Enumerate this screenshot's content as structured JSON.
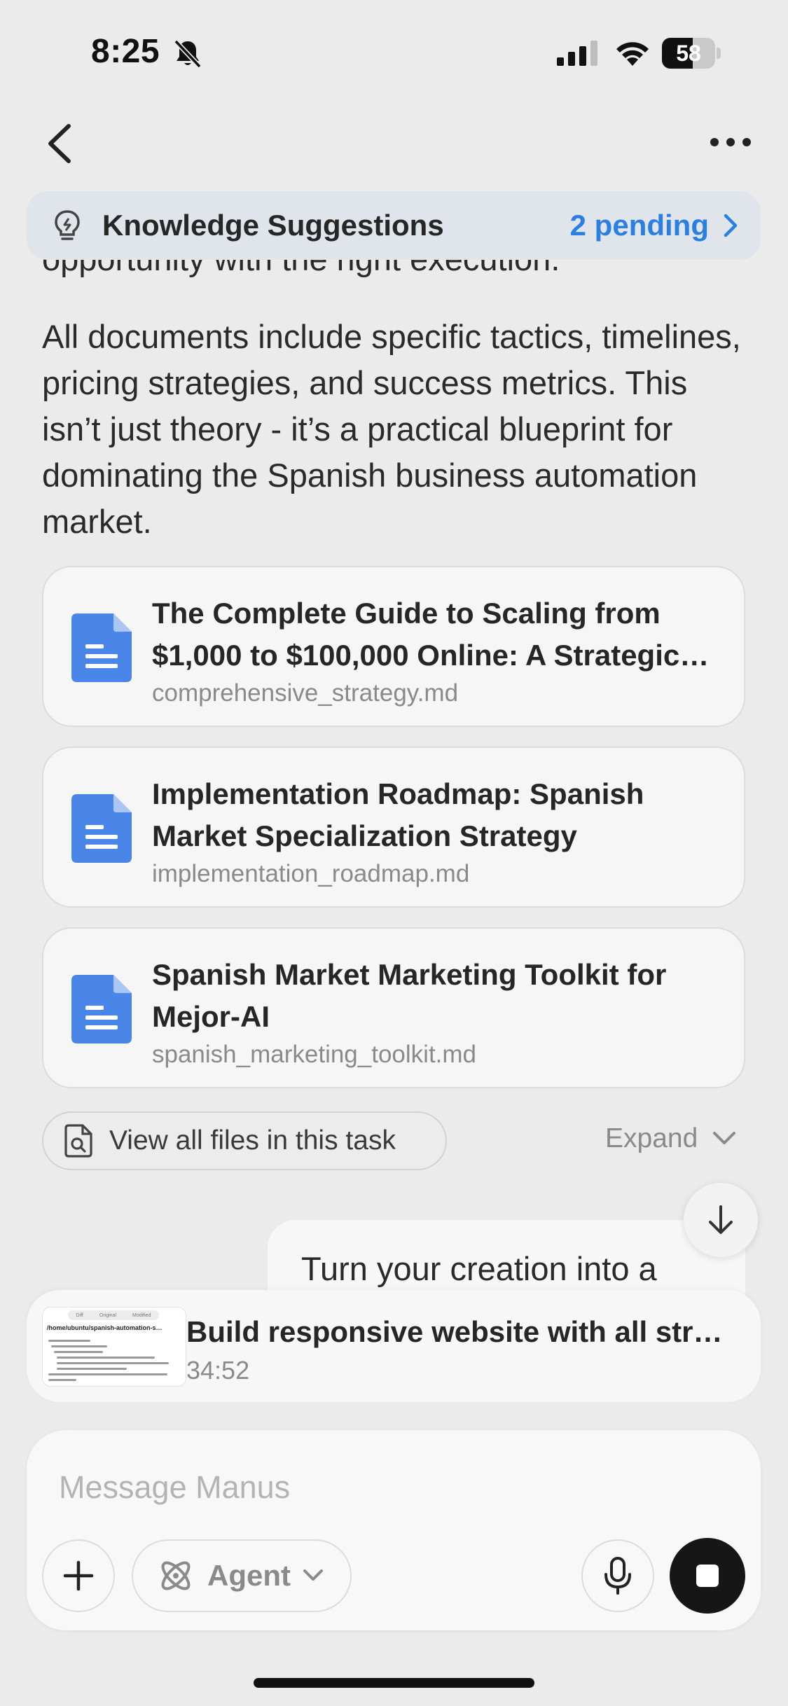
{
  "status_bar": {
    "time": "8:25",
    "battery": "58",
    "battery_level": 0.58,
    "icons": [
      "bell-slash-icon",
      "signal-icon",
      "wifi-icon",
      "battery-icon"
    ]
  },
  "nav": {
    "back_icon": "chevron-left-icon",
    "more_icon": "ellipsis-icon"
  },
  "knowledge": {
    "icon": "lightbulb-icon",
    "title": "Knowledge Suggestions",
    "pending": "2 pending"
  },
  "message": {
    "clipped_line": "opportunity with the right execution.",
    "paragraph": "All documents include specific tactics, timelines, pricing strategies, and success metrics. This isn’t just theory - it’s a practical blueprint for dominating the Spanish business automation market."
  },
  "files": [
    {
      "title": "The Complete Guide to Scaling from $1,000 to $100,000 Online: A Strategic Framework",
      "filename": "comprehensive_strategy.md"
    },
    {
      "title": "Implementation Roadmap: Spanish Market Specialization Strategy",
      "filename": "implementation_roadmap.md"
    },
    {
      "title": "Spanish Market Marketing Toolkit for Mejor-AI",
      "filename": "spanish_marketing_toolkit.md"
    }
  ],
  "view_all": {
    "label": "View all files in this task"
  },
  "expand": {
    "label": "Expand"
  },
  "user_message": {
    "text": "Turn your creation into a"
  },
  "task": {
    "title": "Build responsive website with all str…",
    "time": "34:52",
    "thumb_tabs": [
      "Diff",
      "Original",
      "Modified"
    ],
    "thumb_path": "/home/ubuntu/spanish-automation-s…"
  },
  "composer": {
    "placeholder": "Message Manus",
    "mode_label": "Agent"
  },
  "colors": {
    "accent": "#2a7fe0",
    "doc_icon": "#4a86e8",
    "background": "#ebebeb"
  }
}
